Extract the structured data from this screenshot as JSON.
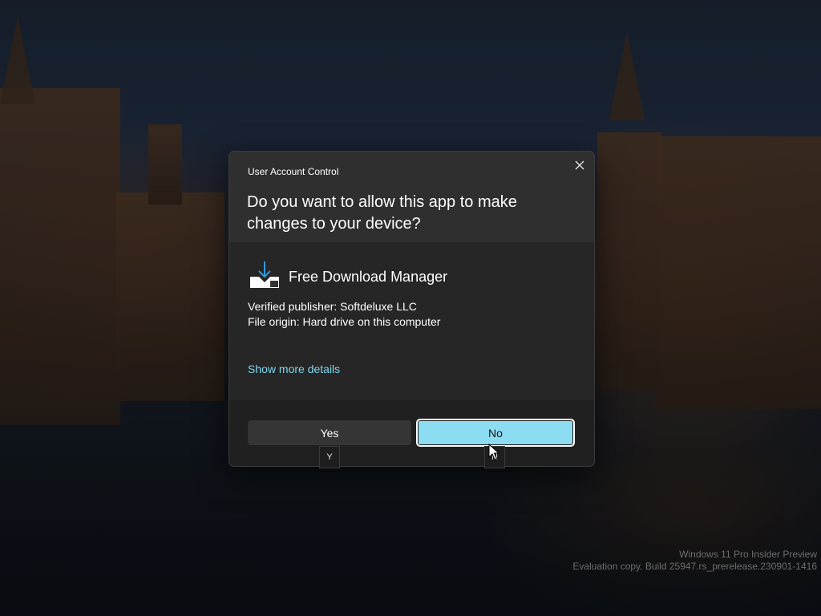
{
  "dialog": {
    "caption": "User Account Control",
    "question": "Do you want to allow this app to make changes to your device?",
    "app_name": "Free Download Manager",
    "publisher": "Verified publisher: Softdeluxe LLC",
    "origin": "File origin: Hard drive on this computer",
    "show_more": "Show more details",
    "yes_label": "Yes",
    "no_label": "No",
    "yes_key": "Y",
    "no_key": "N",
    "close_icon": "close-icon",
    "app_icon": "download-tray-icon"
  },
  "watermark": {
    "line1": "Windows 11 Pro Insider Preview",
    "line2": "Evaluation copy. Build 25947.rs_prerelease.230901-1416"
  },
  "colors": {
    "dialog_bg": "#2b2b2b",
    "accent": "#8cdcf2",
    "link": "#7fd6ee"
  }
}
